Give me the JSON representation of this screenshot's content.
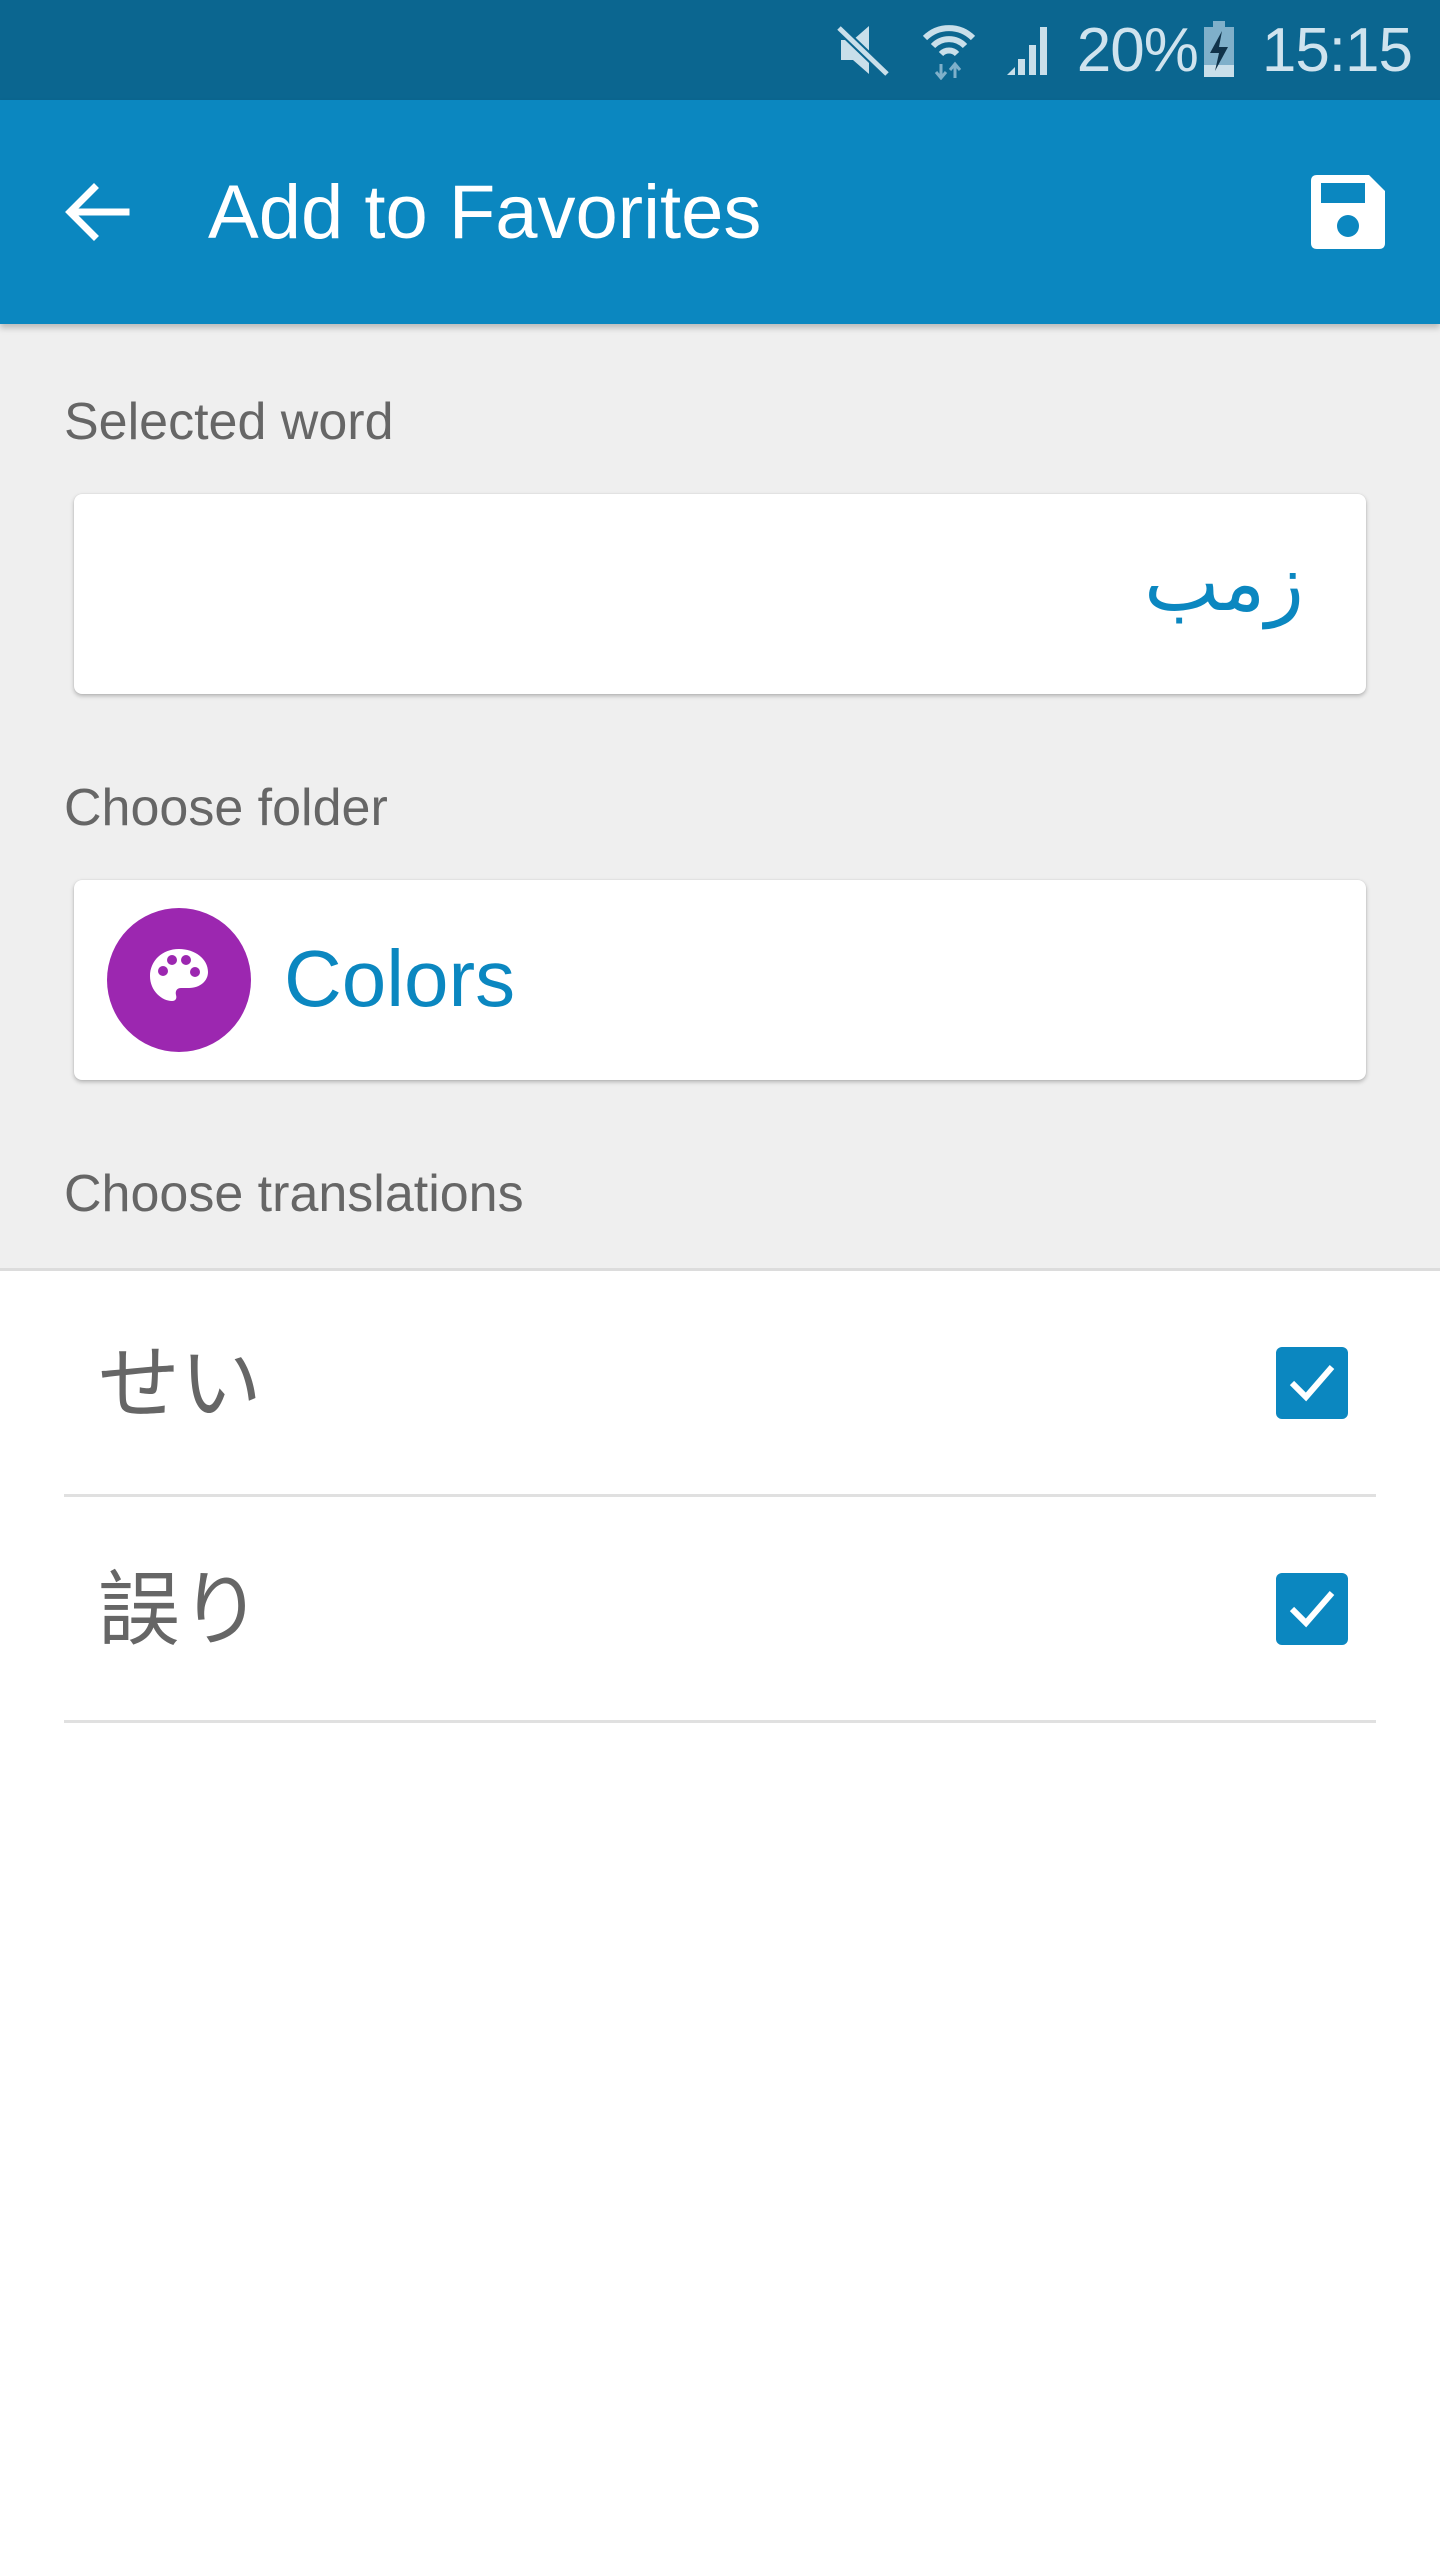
{
  "status_bar": {
    "icons": [
      "mute-icon",
      "wifi-icon",
      "signal-icon",
      "battery-charging-icon"
    ],
    "battery_percent": "20%",
    "time": "15:15"
  },
  "app_bar": {
    "back_icon": "arrow-left-icon",
    "title": "Add to Favorites",
    "save_icon": "floppy-disk-icon"
  },
  "form": {
    "selected_word_label": "Selected word",
    "selected_word_value": "زمب",
    "choose_folder_label": "Choose folder",
    "folder": {
      "name": "Colors",
      "icon": "palette-icon",
      "color": "#9c27b0"
    },
    "choose_translations_label": "Choose translations"
  },
  "translations": [
    {
      "text": "せい",
      "checked": true
    },
    {
      "text": "誤り",
      "checked": true
    }
  ],
  "colors": {
    "status_bar": "#0b6690",
    "app_bar": "#0b87c0",
    "accent": "#0b87c0",
    "form_background": "#efefef"
  }
}
